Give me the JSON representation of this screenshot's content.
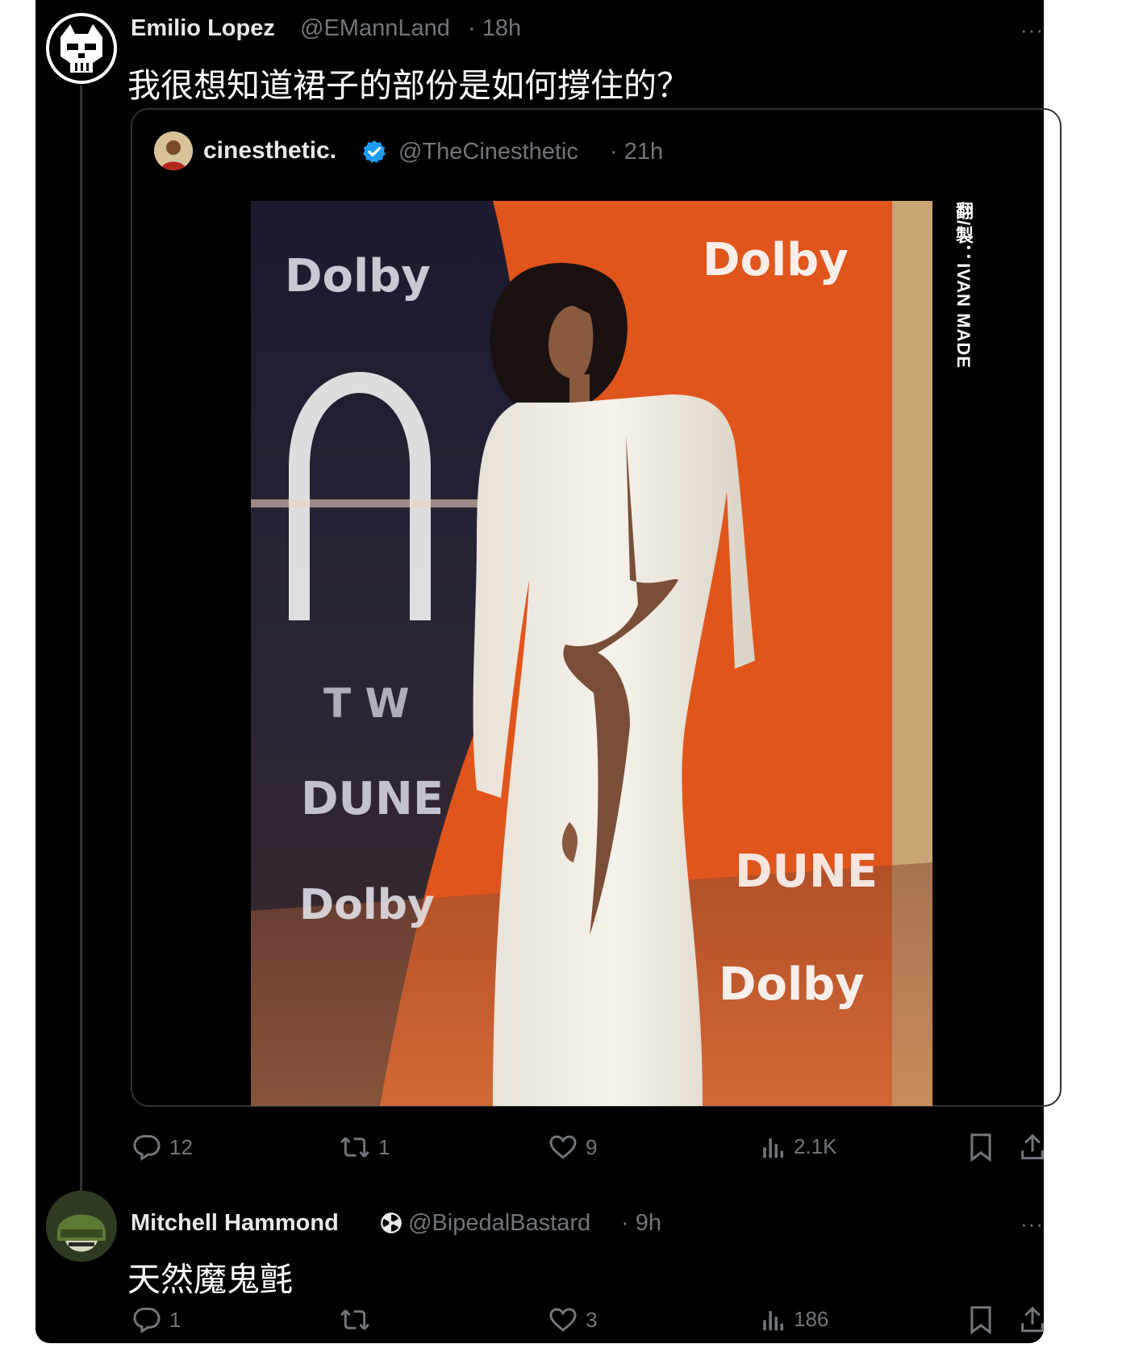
{
  "tweet": {
    "name": "Emilio Lopez",
    "handle": "@EMannLand",
    "time": "· 18h",
    "text": "我很想知道裙子的部份是如何撐住的？",
    "more": "···",
    "actions": {
      "replies": "12",
      "retweets": "1",
      "likes": "9",
      "views": "2.1K"
    }
  },
  "quoted": {
    "name": "cinesthetic.",
    "handle": "@TheCinesthetic",
    "time": "· 21h",
    "photo_signs": [
      "Dolby",
      "Dolby",
      "Dolby",
      "Dolby",
      "DUNE",
      "DUNE",
      "T W"
    ]
  },
  "watermark": "翻/製：IVAN MADE",
  "reply": {
    "name": "Mitchell Hammond",
    "handle": "@BipedalBastard",
    "time": "· 9h",
    "text": "天然魔鬼氈",
    "more": "···",
    "actions": {
      "replies": "1",
      "retweets": "",
      "likes": "3",
      "views": "186"
    }
  },
  "colors": {
    "background": "#000000",
    "text": "#e7e9ea",
    "muted": "#71767b",
    "verified": "#1d9bf0",
    "orange_backdrop": "#e0551c"
  }
}
